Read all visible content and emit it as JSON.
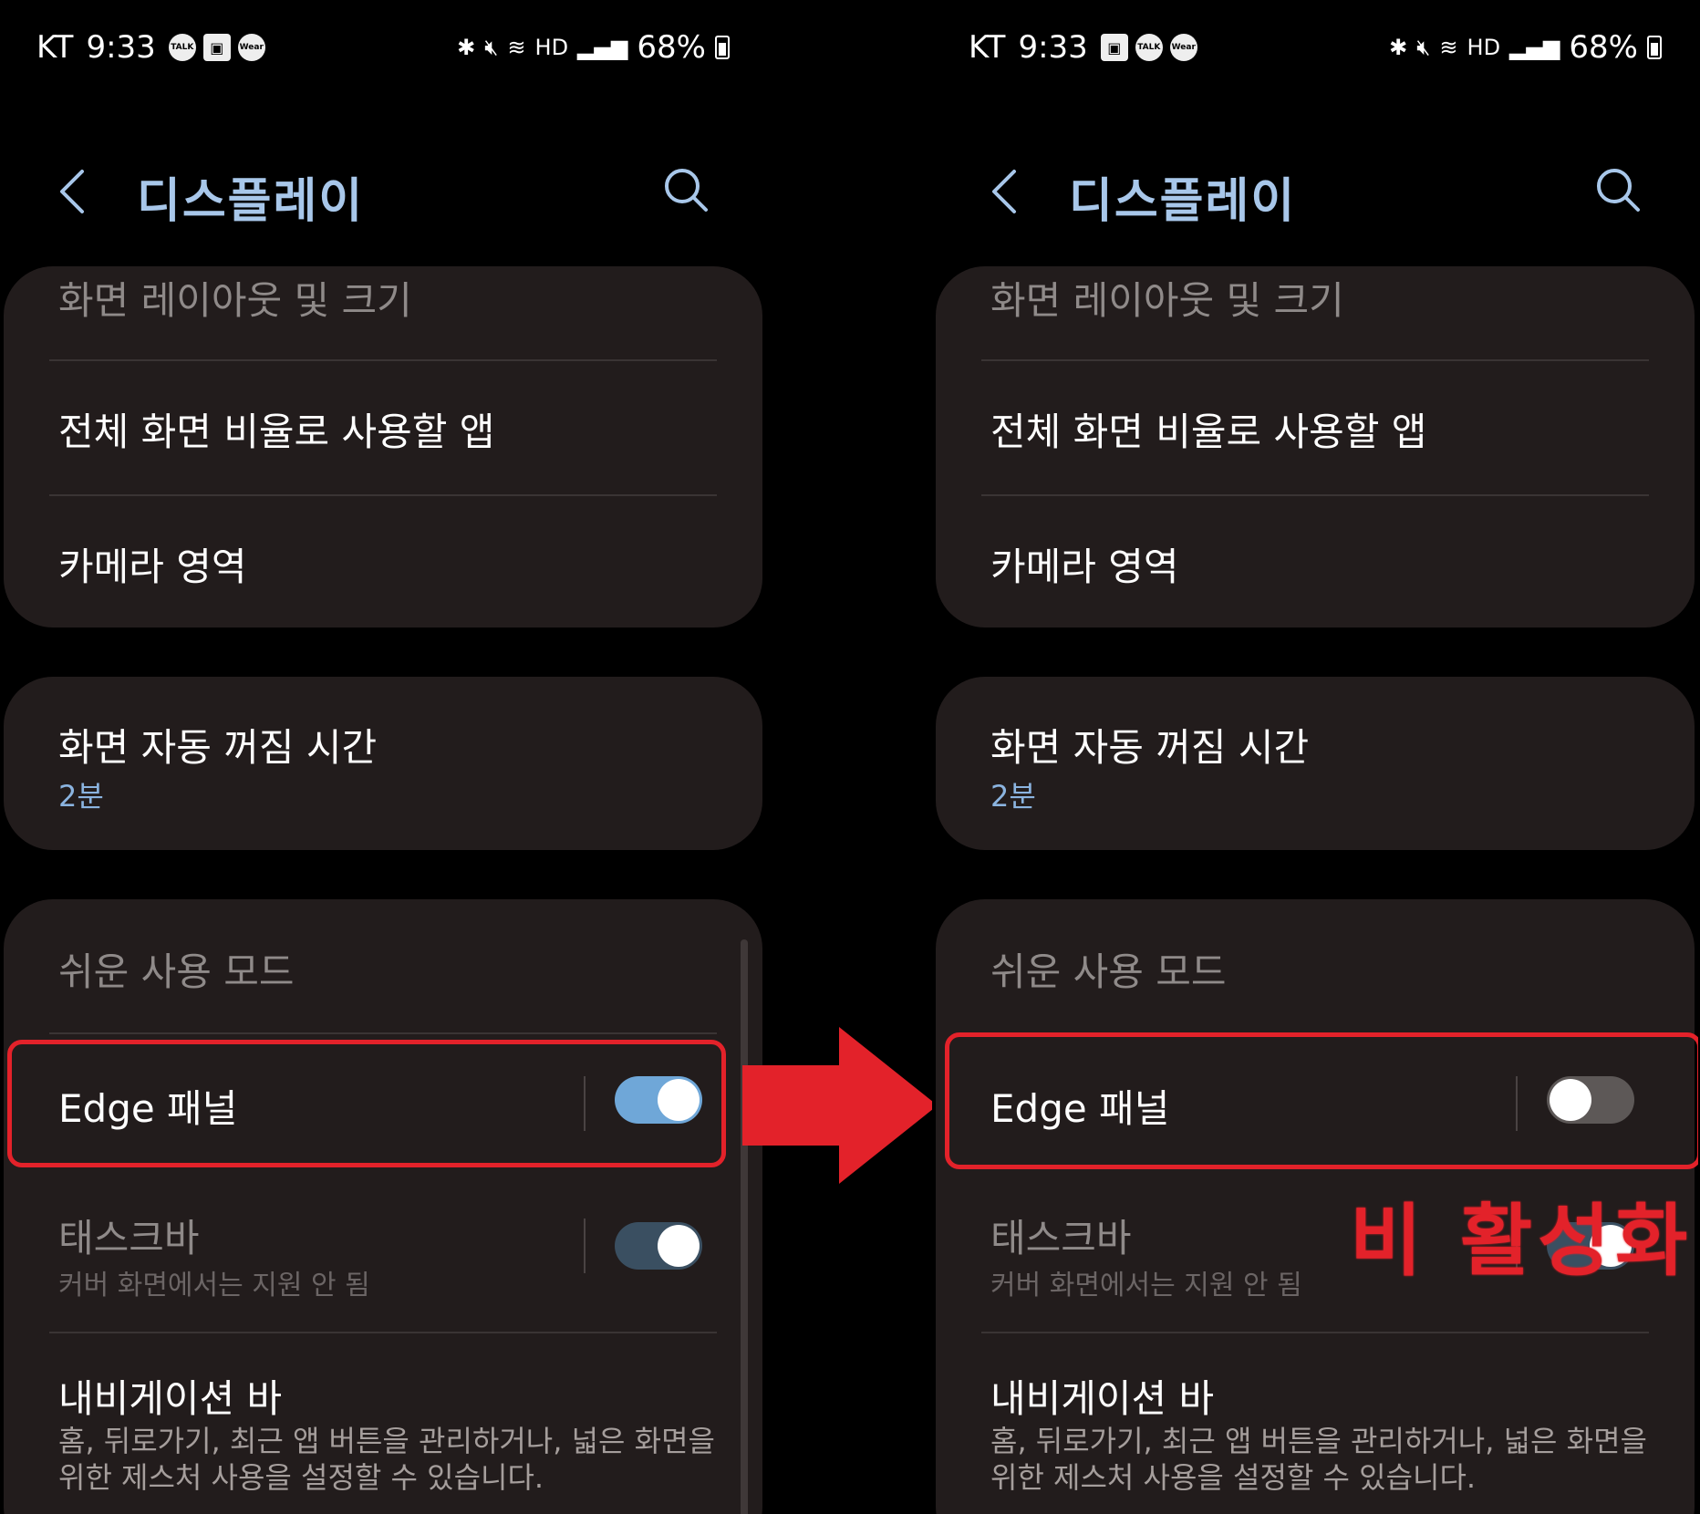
{
  "left": {
    "status": {
      "carrier": "KT",
      "time": "9:33",
      "icons": [
        "talk-icon",
        "gallery-icon",
        "wear-icon"
      ],
      "battery": "68%"
    },
    "header": {
      "title": "디스플레이"
    },
    "cards": {
      "layout_header": "화면 레이아웃 및 크기",
      "fullscreen_apps": "전체 화면 비율로 사용할 앱",
      "camera_area": "카메라 영역",
      "screen_timeout": "화면 자동 꺼짐 시간",
      "screen_timeout_value": "2분",
      "easy_mode": "쉬운 사용 모드",
      "edge_panel": "Edge 패널",
      "edge_panel_on": true,
      "taskbar": "태스크바",
      "taskbar_sub": "커버 화면에서는 지원 안 됨",
      "navbar": "내비게이션 바",
      "navbar_desc_1": "홈, 뒤로가기, 최근 앱 버튼을 관리하거나, 넓은 화면을",
      "navbar_desc_2": "위한 제스처 사용을 설정할 수 있습니다."
    }
  },
  "right": {
    "status": {
      "carrier": "KT",
      "time": "9:33",
      "icons": [
        "gallery-icon",
        "talk-icon",
        "wear-icon"
      ],
      "battery": "68%"
    },
    "header": {
      "title": "디스플레이"
    },
    "cards": {
      "layout_header": "화면 레이아웃 및 크기",
      "fullscreen_apps": "전체 화면 비율로 사용할 앱",
      "camera_area": "카메라 영역",
      "screen_timeout": "화면 자동 꺼짐 시간",
      "screen_timeout_value": "2분",
      "easy_mode": "쉬운 사용 모드",
      "edge_panel": "Edge 패널",
      "edge_panel_on": false,
      "taskbar": "태스크바",
      "taskbar_sub": "커버 화면에서는 지원 안 됨",
      "navbar": "내비게이션 바",
      "navbar_desc_1": "홈, 뒤로가기, 최근 앱 버튼을 관리하거나, 넓은 화면을",
      "navbar_desc_2": "위한 제스처 사용을 설정할 수 있습니다."
    }
  },
  "annotation": {
    "label": "비 활성화"
  },
  "colors": {
    "title": "#a8c7ea",
    "card": "#221c1c",
    "accent": "#6fa7d8",
    "highlight": "#e3222a"
  }
}
